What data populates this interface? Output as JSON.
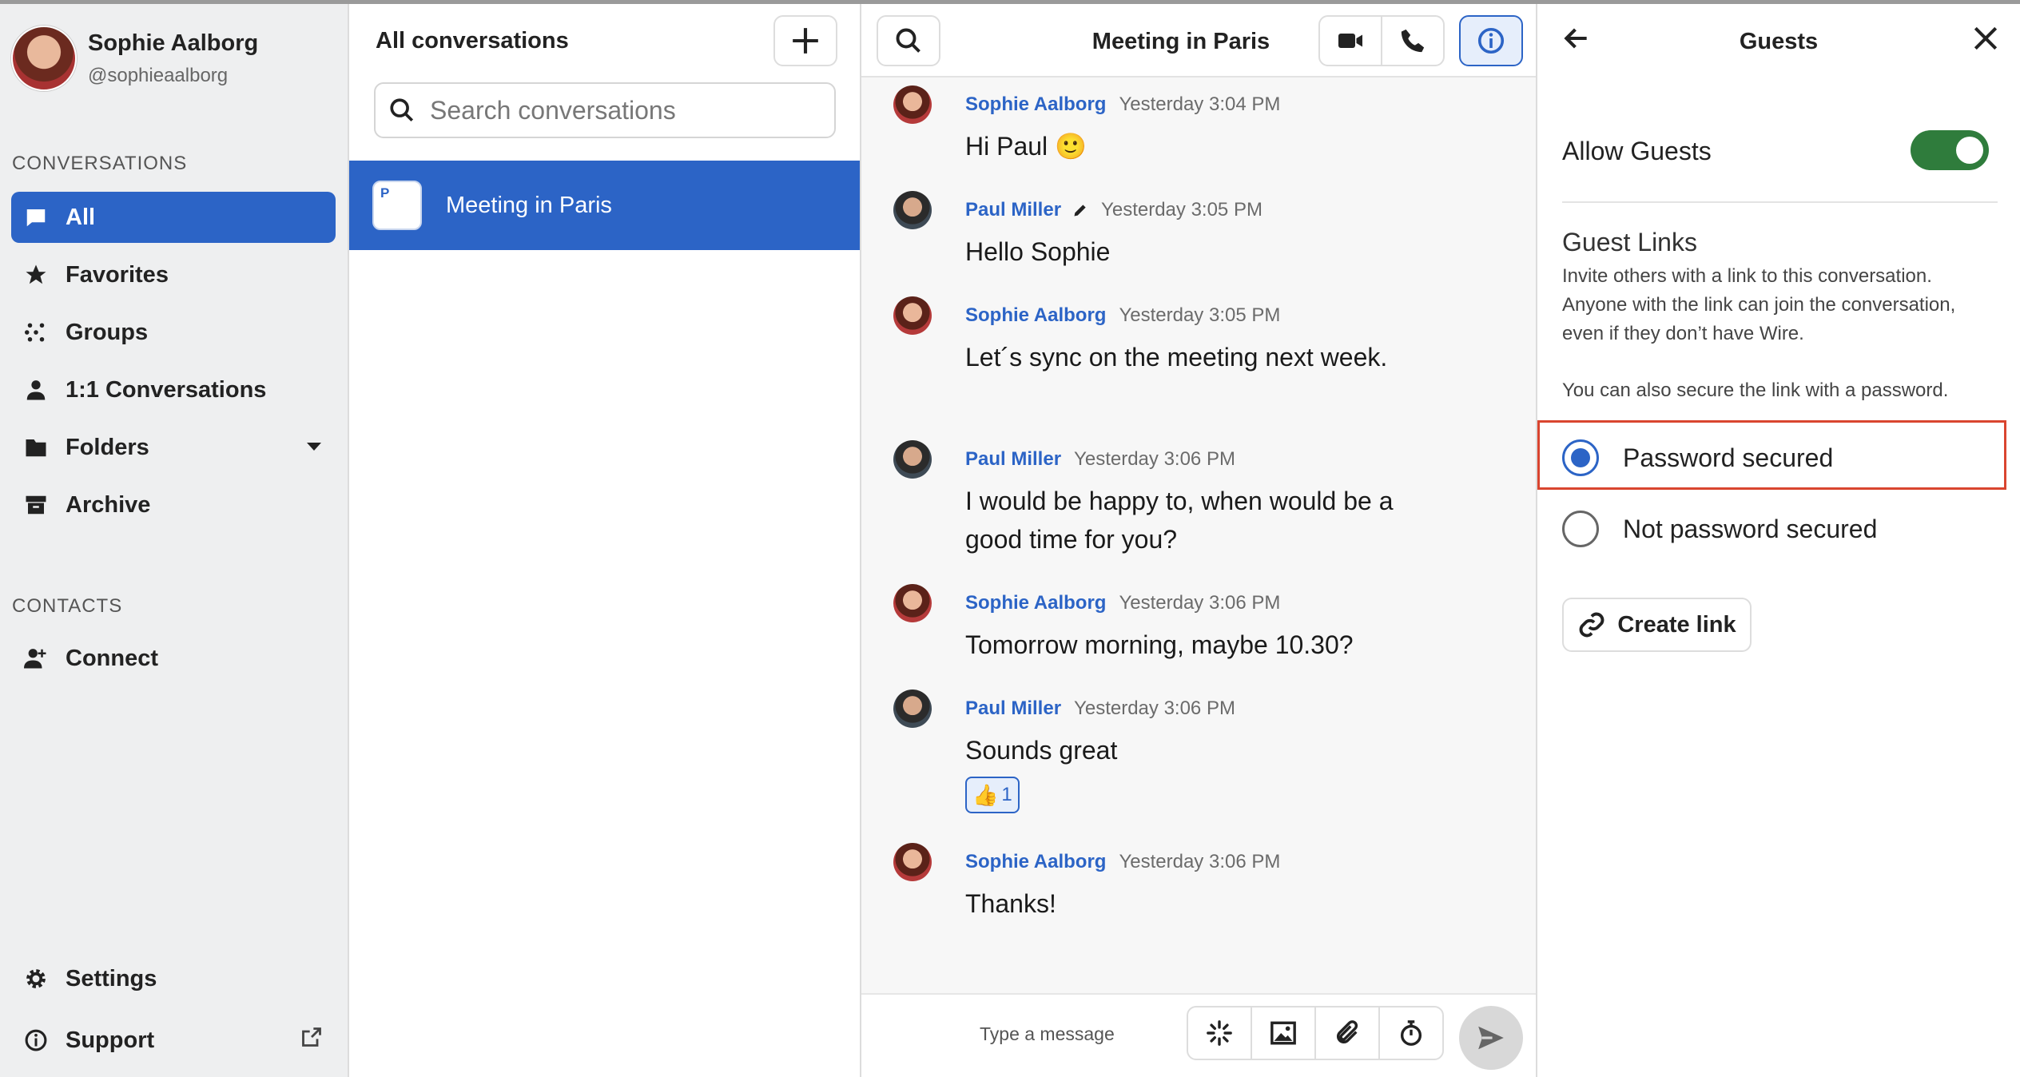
{
  "sidebar": {
    "user_name": "Sophie Aalborg",
    "user_handle": "@sophieaalborg",
    "conversations_label": "CONVERSATIONS",
    "contacts_label": "CONTACTS",
    "nav": {
      "all": "All",
      "favorites": "Favorites",
      "groups": "Groups",
      "one_to_one": "1:1 Conversations",
      "folders": "Folders",
      "archive": "Archive",
      "connect": "Connect",
      "settings": "Settings",
      "support": "Support"
    }
  },
  "conversation_list": {
    "title": "All conversations",
    "search_placeholder": "Search conversations",
    "items": [
      {
        "avatar_letter": "P",
        "name": "Meeting in Paris"
      }
    ]
  },
  "chat": {
    "title": "Meeting in Paris",
    "messages": [
      {
        "author": "Sophie Aalborg",
        "time": "Yesterday 3:04 PM",
        "text": "Hi Paul 🙂"
      },
      {
        "author": "Paul Miller",
        "time": "Yesterday 3:05 PM",
        "text": "Hello Sophie"
      },
      {
        "author": "Sophie Aalborg",
        "time": "Yesterday 3:05 PM",
        "text": "Let´s sync on the meeting next week."
      },
      {
        "author": "Paul Miller",
        "time": "Yesterday 3:06 PM",
        "text_line1": "I would be happy to, when would be a",
        "text_line2": "good time for you?"
      },
      {
        "author": "Sophie Aalborg",
        "time": "Yesterday 3:06 PM",
        "text": "Tomorrow morning, maybe 10.30?"
      },
      {
        "author": "Paul Miller",
        "time": "Yesterday 3:06 PM",
        "text": "Sounds great",
        "reaction_emoji": "👍",
        "reaction_count": "1"
      },
      {
        "author": "Sophie Aalborg",
        "time": "Yesterday 3:06 PM",
        "text": "Thanks!"
      }
    ],
    "composer_placeholder": "Type a message"
  },
  "guests_panel": {
    "title": "Guests",
    "allow_guests_label": "Allow Guests",
    "allow_guests_enabled": true,
    "guest_links_title": "Guest Links",
    "guest_links_desc_1": "Invite others with a link to this conversation.",
    "guest_links_desc_2": "Anyone with the link can join the conversation,",
    "guest_links_desc_3": "even if they don’t have Wire.",
    "password_note": "You can also secure the link with a password.",
    "option_secured": "Password secured",
    "option_not_secured": "Not password secured",
    "selected_option": "Password secured",
    "create_link_label": "Create link"
  },
  "colors": {
    "accent": "#2c64c6",
    "toggle_on": "#2f7c3c",
    "highlight": "#d9452f"
  },
  "icons": [
    "chat-bubble-icon",
    "star-icon",
    "groups-icon",
    "person-icon",
    "folder-icon",
    "archive-icon",
    "add-contact-icon",
    "gear-icon",
    "info-icon",
    "external-link-icon",
    "plus-icon",
    "search-icon",
    "video-icon",
    "phone-icon",
    "pencil-icon",
    "ping-icon",
    "image-icon",
    "paperclip-icon",
    "timer-icon",
    "send-icon",
    "back-arrow-icon",
    "close-icon",
    "link-icon"
  ]
}
